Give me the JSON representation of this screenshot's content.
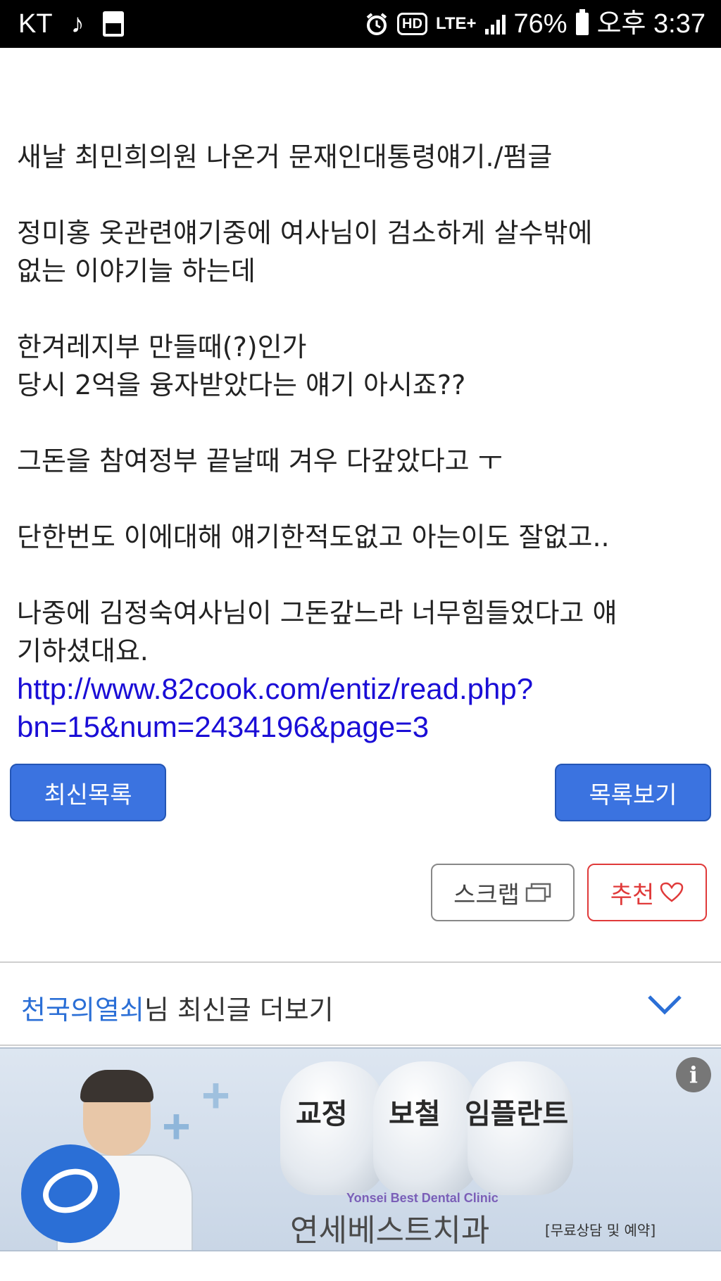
{
  "status_bar": {
    "carrier": "KT",
    "music_icon": "music-note-icon",
    "sd_icon": "sd-card-icon",
    "hd_label": "HD",
    "network": "LTE+",
    "battery_percent": "76%",
    "time": "오후 3:37"
  },
  "article": {
    "lines": [
      "새날 최민희의원 나온거 문재인대통령얘기./펌글",
      "",
      "정미홍 옷관련얘기중에 여사님이 검소하게 살수밖에",
      "없는 이야기늘 하는데",
      "",
      "한겨레지부 만들때(?)인가",
      "당시 2억을 융자받았다는 얘기 아시죠??",
      "",
      "그돈을 참여정부 끝날때 겨우 다갚았다고 ㅜ",
      "",
      "단한번도 이에대해 얘기한적도없고 아는이도 잘없고..",
      "",
      "나중에 김정숙여사님이 그돈갚느라 너무힘들었다고 얘",
      "기하셨대요."
    ],
    "link_line1": "http://www.82cook.com/entiz/read.php?",
    "link_line2": "bn=15&num=2434196&page=3"
  },
  "buttons": {
    "latest_list": "최신목록",
    "view_list": "목록보기",
    "scrap": "스크랩",
    "recommend": "추천"
  },
  "more_posts": {
    "author": "천국의열쇠",
    "suffix": "님 최신글 더보기"
  },
  "ad": {
    "service_1": "교정",
    "service_2": "보철",
    "service_3": "임플란트",
    "clinic_en": "Yonsei Best Dental Clinic",
    "clinic_name": "연세베스트치과",
    "consult": "[무료상담 및 예약]",
    "info_label": "i"
  },
  "colors": {
    "link": "#1a0dd6",
    "button_blue": "#3b73e0",
    "recommend_red": "#e03a3a",
    "author_blue": "#2b6fd6"
  }
}
